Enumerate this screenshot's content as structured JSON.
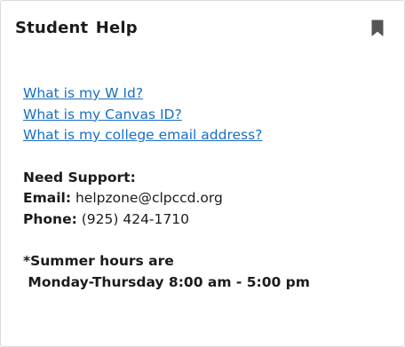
{
  "card": {
    "title": "Student Help",
    "bookmark_icon": "bookmark-icon"
  },
  "links": [
    "What is my W Id?",
    "What is my Canvas ID?",
    "What is my college email address?"
  ],
  "support": {
    "heading": "Need Support:",
    "email_label": "Email:",
    "email_value": "helpzone@clpccd.org",
    "phone_label": "Phone:",
    "phone_value": "(925) 424-1710"
  },
  "hours": {
    "line1": "*Summer hours are",
    "line2": " Monday-Thursday 8:00 am - 5:00 pm"
  },
  "colors": {
    "link": "#1a6ec4",
    "text": "#1b1b1b",
    "icon": "#555555"
  }
}
